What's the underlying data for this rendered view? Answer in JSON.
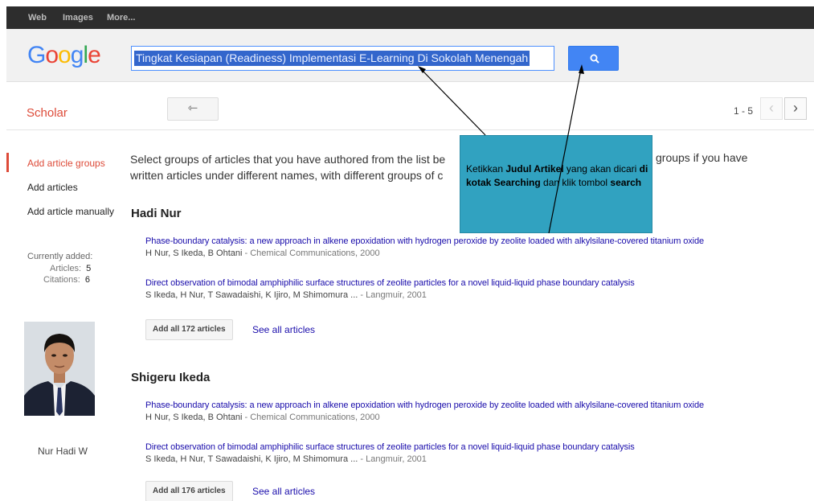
{
  "topnav": [
    "Web",
    "Images",
    "More..."
  ],
  "logo": "Google",
  "search": {
    "query": "Tingkat Kesiapan (Readiness) Implementasi E-Learning Di Sokolah Menengah"
  },
  "scholar": "Scholar",
  "back_icon": "back-arrow-icon",
  "pagination": {
    "range": "1 - 5",
    "prev": "‹",
    "next": "›"
  },
  "sidebar": {
    "items": [
      "Add article groups",
      "Add articles",
      "Add article manually"
    ],
    "currently_added": "Currently added:",
    "articles_label": "Articles:",
    "articles_value": "5",
    "citations_label": "Citations:",
    "citations_value": "6",
    "photo_name": "Nur Hadi W"
  },
  "intro": {
    "text": "Select groups of articles that you have authored from the list be written articles under different names, with different groups of c",
    "tail": "groups if you have"
  },
  "callout": {
    "p1": "Ketikkan ",
    "b1": "Judul Artikel",
    "p2": " yang akan dicari ",
    "b2": "di kotak Searching",
    "p3": " dan klik tombol ",
    "b3": "search"
  },
  "groups": [
    {
      "author": "Hadi Nur",
      "articles": [
        {
          "title": "Phase-boundary catalysis: a new approach in alkene epoxidation with hydrogen peroxide by zeolite loaded with alkylsilane-covered titanium oxide",
          "meta_authors": "H Nur, S Ikeda, B Ohtani",
          "meta_source": " - Chemical Communications, 2000"
        },
        {
          "title": "Direct observation of bimodal amphiphilic surface structures of zeolite particles for a novel liquid-liquid phase boundary catalysis",
          "meta_authors": "S Ikeda, H Nur, T Sawadaishi, K Ijiro, M Shimomura ...",
          "meta_source": " - Langmuir, 2001"
        }
      ],
      "add_all": "Add all 172 articles",
      "see_all": "See all articles"
    },
    {
      "author": "Shigeru Ikeda",
      "articles": [
        {
          "title": "Phase-boundary catalysis: a new approach in alkene epoxidation with hydrogen peroxide by zeolite loaded with alkylsilane-covered titanium oxide",
          "meta_authors": "H Nur, S Ikeda, B Ohtani",
          "meta_source": " - Chemical Communications, 2000"
        },
        {
          "title": "Direct observation of bimodal amphiphilic surface structures of zeolite particles for a novel liquid-liquid phase boundary catalysis",
          "meta_authors": "S Ikeda, H Nur, T Sawadaishi, K Ijiro, M Shimomura ...",
          "meta_source": " - Langmuir, 2001"
        }
      ],
      "add_all": "Add all 176 articles",
      "see_all": "See all articles"
    }
  ],
  "colors": {
    "accent_red": "#dd4b39",
    "search_blue": "#4285f4",
    "link": "#1a0dab",
    "callout": "#31a2c0"
  }
}
